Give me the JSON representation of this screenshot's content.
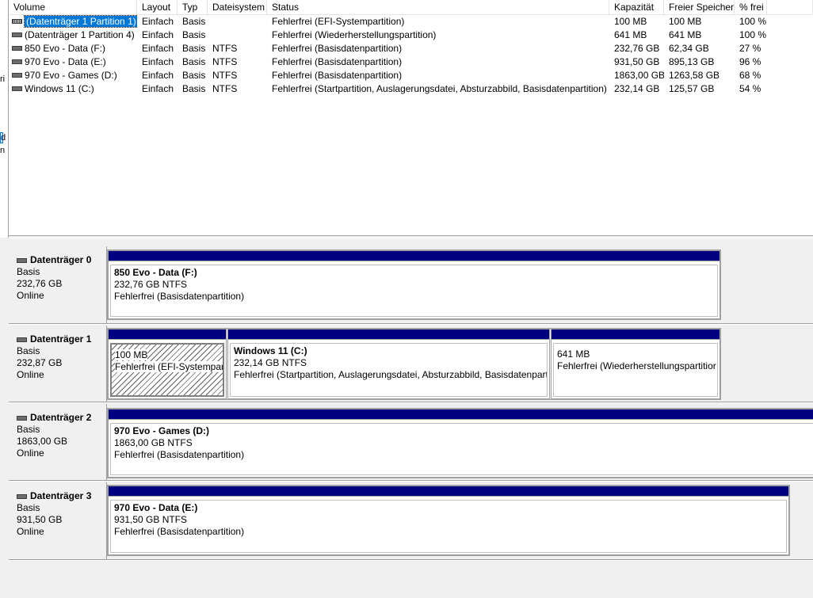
{
  "gutter_fragments": [
    "ri",
    "d",
    "n"
  ],
  "columns": {
    "volume": "Volume",
    "layout": "Layout",
    "typ": "Typ",
    "dateisystem": "Dateisystem",
    "status": "Status",
    "kapazitaet": "Kapazität",
    "frei": "Freier Speicher",
    "prozent": "% frei"
  },
  "volumes": [
    {
      "volume": "(Datenträger 1 Partition 1)",
      "layout": "Einfach",
      "typ": "Basis",
      "fs": "",
      "status": "Fehlerfrei (EFI-Systempartition)",
      "kapazitaet": "100 MB",
      "frei": "100 MB",
      "prozent": "100 %",
      "icon": "hatched-volume-icon",
      "selected": true
    },
    {
      "volume": "(Datenträger 1 Partition 4)",
      "layout": "Einfach",
      "typ": "Basis",
      "fs": "",
      "status": "Fehlerfrei (Wiederherstellungspartition)",
      "kapazitaet": "641 MB",
      "frei": "641 MB",
      "prozent": "100 %",
      "icon": "volume-icon",
      "selected": false
    },
    {
      "volume": "850 Evo - Data (F:)",
      "layout": "Einfach",
      "typ": "Basis",
      "fs": "NTFS",
      "status": "Fehlerfrei (Basisdatenpartition)",
      "kapazitaet": "232,76 GB",
      "frei": "62,34 GB",
      "prozent": "27 %",
      "icon": "volume-icon",
      "selected": false
    },
    {
      "volume": "970 Evo - Data (E:)",
      "layout": "Einfach",
      "typ": "Basis",
      "fs": "NTFS",
      "status": "Fehlerfrei (Basisdatenpartition)",
      "kapazitaet": "931,50 GB",
      "frei": "895,13 GB",
      "prozent": "96 %",
      "icon": "volume-icon",
      "selected": false
    },
    {
      "volume": "970 Evo - Games (D:)",
      "layout": "Einfach",
      "typ": "Basis",
      "fs": "NTFS",
      "status": "Fehlerfrei (Basisdatenpartition)",
      "kapazitaet": "1863,00 GB",
      "frei": "1263,58 GB",
      "prozent": "68 %",
      "icon": "volume-icon",
      "selected": false
    },
    {
      "volume": "Windows 11 (C:)",
      "layout": "Einfach",
      "typ": "Basis",
      "fs": "NTFS",
      "status": "Fehlerfrei (Startpartition, Auslagerungsdatei, Absturzabbild, Basisdatenpartition)",
      "kapazitaet": "232,14 GB",
      "frei": "125,57 GB",
      "prozent": "54 %",
      "icon": "volume-icon",
      "selected": false
    }
  ],
  "disks": [
    {
      "name": "Datenträger 0",
      "type": "Basis",
      "size": "232,76 GB",
      "state": "Online",
      "partitions": [
        {
          "name": "850 Evo - Data  (F:)",
          "line2": "232,76 GB NTFS",
          "line3": "Fehlerfrei (Basisdatenpartition)",
          "selected": false
        }
      ]
    },
    {
      "name": "Datenträger 1",
      "type": "Basis",
      "size": "232,87 GB",
      "state": "Online",
      "partitions": [
        {
          "name": "",
          "line2": "100 MB",
          "line3": "Fehlerfrei (EFI-Systempart",
          "selected": true
        },
        {
          "name": "Windows 11  (C:)",
          "line2": "232,14 GB NTFS",
          "line3": "Fehlerfrei (Startpartition, Auslagerungsdatei, Absturzabbild, Basisdatenpart",
          "selected": false
        },
        {
          "name": "",
          "line2": "641 MB",
          "line3": "Fehlerfrei (Wiederherstellungspartitior",
          "selected": false
        }
      ]
    },
    {
      "name": "Datenträger 2",
      "type": "Basis",
      "size": "1863,00 GB",
      "state": "Online",
      "partitions": [
        {
          "name": "970 Evo - Games  (D:)",
          "line2": "1863,00 GB NTFS",
          "line3": "Fehlerfrei (Basisdatenpartition)",
          "selected": false
        }
      ]
    },
    {
      "name": "Datenträger 3",
      "type": "Basis",
      "size": "931,50 GB",
      "state": "Online",
      "partitions": [
        {
          "name": "970 Evo - Data  (E:)",
          "line2": "931,50 GB NTFS",
          "line3": "Fehlerfrei (Basisdatenpartition)",
          "selected": false
        }
      ]
    }
  ],
  "colors": {
    "partition_bar": "#000080",
    "selection": "#0078d7"
  }
}
